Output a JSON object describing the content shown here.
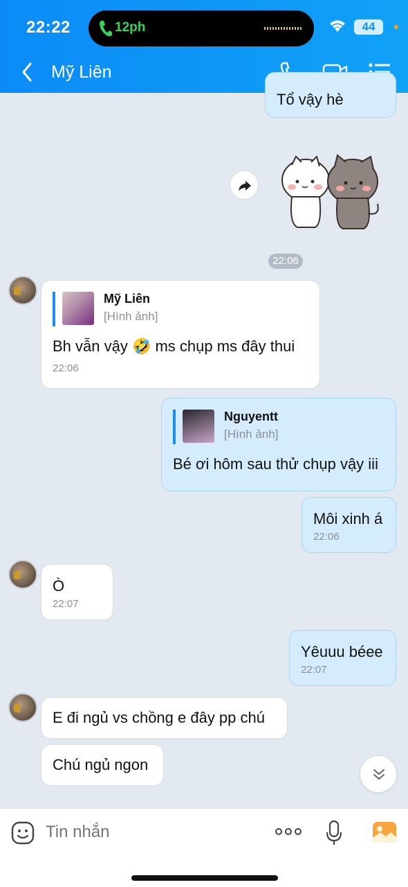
{
  "status_bar": {
    "time": "22:22",
    "call_duration": "12ph",
    "battery": "44"
  },
  "header": {
    "title": "Mỹ Liên"
  },
  "messages": {
    "m0": {
      "text": "Tổ vậy hè"
    },
    "divider": {
      "time": "22:06"
    },
    "m1": {
      "quote_name": "Mỹ Liên",
      "quote_type": "[Hình ảnh]",
      "text": "Bh vẫn vậy 🤣 ms chụp ms đây thui",
      "time": "22:06"
    },
    "m2": {
      "quote_name": "Nguyentt",
      "quote_type": "[Hình ảnh]",
      "text": "Bé ơi hôm sau thử chụp vậy iii"
    },
    "m3": {
      "text": "Môi xinh á",
      "time": "22:06"
    },
    "m4": {
      "text": "Ò",
      "time": "22:07"
    },
    "m5": {
      "text": "Yêuuu béee",
      "time": "22:07"
    },
    "m6": {
      "text": "E đi ngủ vs chồng e đây pp chú"
    },
    "m7": {
      "text": "Chú ngủ ngon"
    }
  },
  "input": {
    "placeholder": "Tin nhắn"
  },
  "colors": {
    "header": "#0c8bf7",
    "outgoing_bubble": "#d4ecfc",
    "incoming_bubble": "#ffffff",
    "background": "#e2e9f1",
    "accent": "#1a8cf3"
  },
  "icons": [
    "phone-icon",
    "video-call-icon",
    "menu-icon",
    "back-icon",
    "share-icon",
    "chevron-double-down-icon",
    "sticker-icon",
    "more-icon",
    "microphone-icon",
    "image-icon"
  ]
}
